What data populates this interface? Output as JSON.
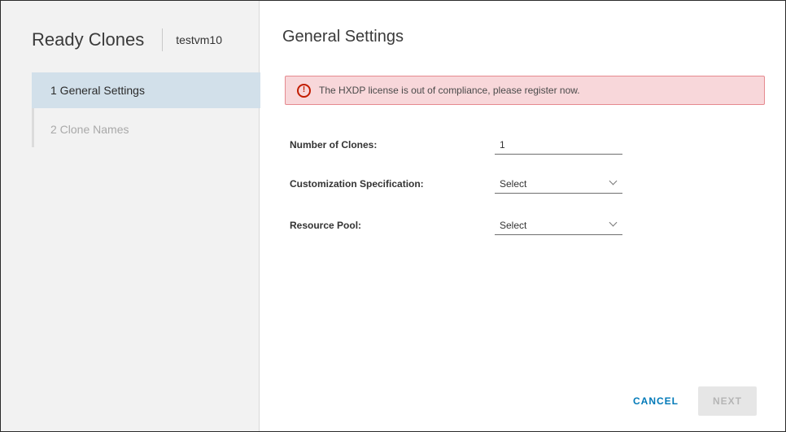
{
  "wizard": {
    "title": "Ready Clones",
    "vm_name": "testvm10",
    "steps": [
      {
        "label": "1 General Settings",
        "active": true
      },
      {
        "label": "2 Clone Names",
        "active": false
      }
    ]
  },
  "page": {
    "title": "General Settings"
  },
  "alert": {
    "icon": "error-circle-icon",
    "message": "The HXDP license is out of compliance, please register now."
  },
  "form": {
    "number_of_clones": {
      "label": "Number of Clones:",
      "value": "1"
    },
    "customization_spec": {
      "label": "Customization Specification:",
      "value": "Select"
    },
    "resource_pool": {
      "label": "Resource Pool:",
      "value": "Select"
    }
  },
  "footer": {
    "cancel_label": "CANCEL",
    "next_label": "NEXT"
  },
  "colors": {
    "alert_bg": "#f8d7da",
    "alert_border": "#e58a8f",
    "link_blue": "#0079b8",
    "active_step_bg": "#d2e0ea"
  }
}
